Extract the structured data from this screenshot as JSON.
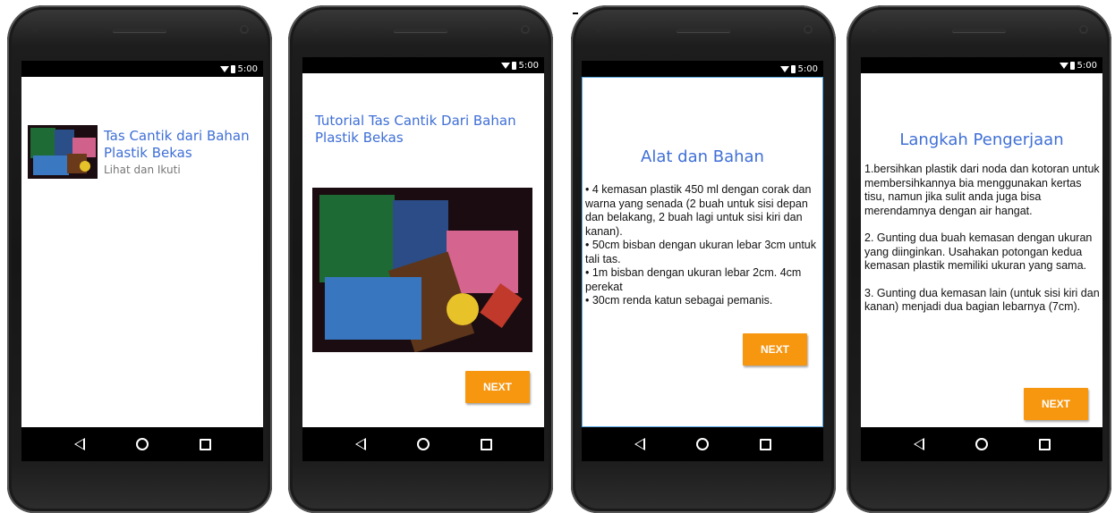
{
  "status": {
    "time": "5:00"
  },
  "screens": [
    {
      "title": "Tas Cantik dari Bahan Plastik Bekas",
      "subtitle": "Lihat dan Ikuti"
    },
    {
      "title": "Tutorial Tas Cantik Dari Bahan Plastik Bekas",
      "next_label": "NEXT"
    },
    {
      "heading": "Alat dan Bahan",
      "items": [
        "• 4 kemasan plastik 450 ml dengan corak dan warna yang senada (2 buah untuk sisi depan dan belakang, 2 buah lagi untuk sisi kiri dan kanan).",
        "• 50cm bisban dengan ukuran lebar 3cm untuk tali tas.",
        "• 1m bisban dengan ukuran lebar 2cm. 4cm perekat",
        "• 30cm renda katun sebagai pemanis."
      ],
      "next_label": "NEXT"
    },
    {
      "heading": "Langkah Pengerjaan",
      "steps": [
        "1.bersihkan plastik dari noda dan kotoran untuk membersihkannya bia menggunakan kertas tisu, namun jika sulit anda juga bisa merendamnya dengan air hangat.",
        "2. Gunting dua buah kemasan dengan ukuran yang diinginkan. Usahakan potongan kedua kemasan plastik memiliki ukuran yang sama.",
        "3. Gunting dua kemasan lain (untuk sisi kiri dan kanan) menjadi dua bagian lebarnya (7cm)."
      ],
      "next_label": "NEXT"
    }
  ],
  "separator_mark": "-",
  "colors": {
    "accent": "#f7960f",
    "title_blue": "#3f6fd6"
  },
  "icons": [
    "wifi-icon",
    "battery-icon",
    "back-icon",
    "home-icon",
    "recents-icon"
  ]
}
